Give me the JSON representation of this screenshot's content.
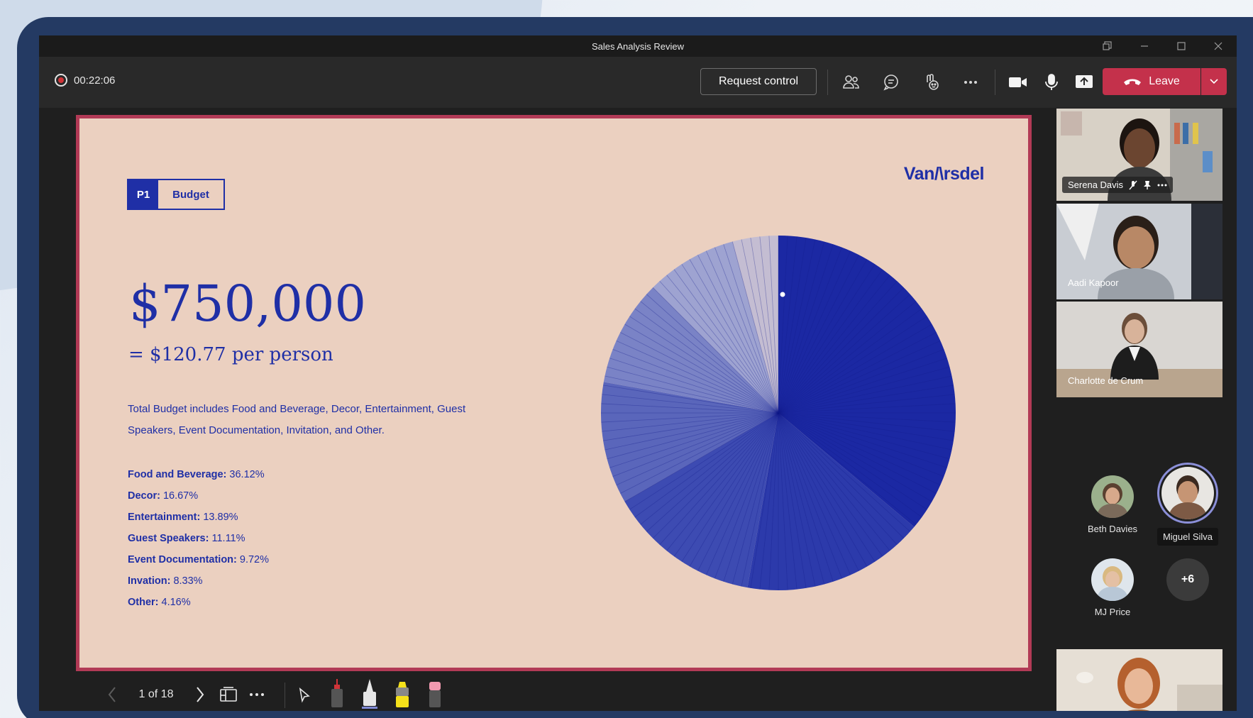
{
  "window": {
    "title": "Sales Analysis Review",
    "controls": [
      "restore-icon",
      "minimize-icon",
      "maximize-icon",
      "close-icon"
    ]
  },
  "toolbar": {
    "recording_time": "00:22:06",
    "request_control_label": "Request control",
    "leave_label": "Leave",
    "icons": [
      "people-icon",
      "chat-icon",
      "reactions-icon",
      "more-icon",
      "camera-icon",
      "mic-icon",
      "share-icon"
    ]
  },
  "slide": {
    "tag_id": "P1",
    "tag_label": "Budget",
    "logo": "Van/\\rsdel",
    "amount": "$750,000",
    "per_person": "= $120.77 per person",
    "description": "Total Budget includes Food and Beverage, Decor, Entertainment, Guest Speakers, Event Documentation, Invitation, and Other.",
    "breakdown": [
      {
        "label": "Food and Beverage:",
        "value": " 36.12%"
      },
      {
        "label": "Decor:",
        "value": " 16.67%"
      },
      {
        "label": "Entertainment:",
        "value": " 13.89%"
      },
      {
        "label": "Guest Speakers:",
        "value": " 11.11%"
      },
      {
        "label": "Event Documentation:",
        "value": " 9.72%"
      },
      {
        "label": "Invation:",
        "value": " 8.33%"
      },
      {
        "label": "Other:",
        "value": " 4.16%"
      }
    ],
    "colors": {
      "primary": "#1f2fa6",
      "background": "#ebd0c0",
      "frame": "#b23a56"
    }
  },
  "chart_data": {
    "type": "pie",
    "categories": [
      "Food and Beverage",
      "Decor",
      "Entertainment",
      "Guest Speakers",
      "Event Documentation",
      "Invation",
      "Other"
    ],
    "values": [
      36.12,
      16.67,
      13.89,
      11.11,
      9.72,
      8.33,
      4.16
    ],
    "title": "",
    "colors": [
      "#1b28a3",
      "#2c3aab",
      "#3d4bb2",
      "#5a66bb",
      "#7a83c6",
      "#9ea3d1",
      "#c4bdd2"
    ]
  },
  "presentation_controls": {
    "page_indicator": "1 of 18",
    "icons": [
      "previous-icon",
      "next-icon",
      "grid-view-icon",
      "more-icon",
      "pointer-icon",
      "red-pen-icon",
      "white-pen-icon",
      "highlighter-icon",
      "eraser-icon"
    ]
  },
  "participants": {
    "video_tiles": [
      {
        "name": "Serena Davis",
        "skin": "#6b4530",
        "bg": "#d8d1c6"
      },
      {
        "name": "Aadi Kapoor",
        "skin": "#b88866",
        "bg": "#c9cdd3"
      },
      {
        "name": "Charlotte de Crum",
        "skin": "#d8b39a",
        "bg": "#d9d6d2"
      }
    ],
    "avatars": [
      {
        "name": "Beth Davies",
        "color": "#7b6a5a"
      },
      {
        "name": "Miguel Silva",
        "color": "#7d5a45"
      },
      {
        "name": "MJ Price",
        "color": "#b8c7d6"
      }
    ],
    "more_count": "+6",
    "self_view_bg": "#e6dfd5"
  }
}
